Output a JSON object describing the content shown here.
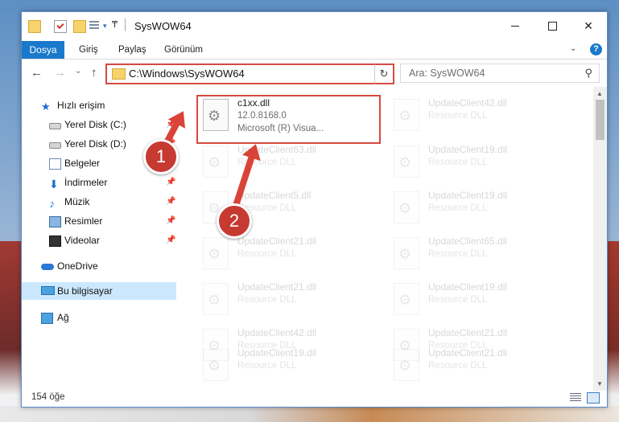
{
  "window": {
    "title": "SysWOW64"
  },
  "ribbon": {
    "tabs": [
      "Dosya",
      "Giriş",
      "Paylaş",
      "Görünüm"
    ],
    "help": "?"
  },
  "nav": {
    "address": "C:\\Windows\\SysWOW64",
    "search_placeholder": "Ara: SysWOW64"
  },
  "sidebar": {
    "items": [
      {
        "label": "Hızlı erişim",
        "icon": "star-icon"
      },
      {
        "label": "Yerel Disk (C:)",
        "icon": "disk-icon",
        "pinned": true
      },
      {
        "label": "Yerel Disk (D:)",
        "icon": "disk-icon",
        "pinned": true
      },
      {
        "label": "Belgeler",
        "icon": "documents-icon",
        "pinned": true
      },
      {
        "label": "İndirmeler",
        "icon": "download-icon",
        "pinned": true
      },
      {
        "label": "Müzik",
        "icon": "music-icon",
        "pinned": true
      },
      {
        "label": "Resimler",
        "icon": "pictures-icon",
        "pinned": true
      },
      {
        "label": "Videolar",
        "icon": "video-icon",
        "pinned": true
      },
      {
        "label": "OneDrive",
        "icon": "cloud-icon"
      },
      {
        "label": "Bu bilgisayar",
        "icon": "computer-icon",
        "selected": true
      },
      {
        "label": "Ağ",
        "icon": "network-icon"
      }
    ]
  },
  "files": [
    {
      "name": "c1xx.dll",
      "line2": "12.0.8168.0",
      "line3": "Microsoft (R) Visua..."
    },
    {
      "name": "UpdateClient42.dll",
      "line2": "Resource DLL"
    },
    {
      "name": "UpdateClient63.dll",
      "line2": "Resource DLL"
    },
    {
      "name": "UpdateClient19.dll",
      "line2": "Resource DLL"
    },
    {
      "name": "UpdateClient5.dll",
      "line2": "Resource DLL"
    },
    {
      "name": "UpdateClient19.dll",
      "line2": "Resource DLL"
    },
    {
      "name": "UpdateClient21.dll",
      "line2": "Resource DLL"
    },
    {
      "name": "UpdateClient65.dll",
      "line2": "Resource DLL"
    },
    {
      "name": "UpdateClient21.dll",
      "line2": "Resource DLL"
    },
    {
      "name": "UpdateClient19.dll",
      "line2": "Resource DLL"
    },
    {
      "name": "UpdateClient42.dll",
      "line2": "Resource DLL"
    },
    {
      "name": "UpdateClient21.dll",
      "line2": "Resource DLL"
    },
    {
      "name": "UpdateClient19.dll",
      "line2": "Resource DLL"
    },
    {
      "name": "UpdateClient21.dll",
      "line2": "Resource DLL"
    }
  ],
  "status": {
    "count": "154 öğe"
  },
  "annotations": {
    "step1": "1",
    "step2": "2",
    "color": "#d64a41"
  }
}
